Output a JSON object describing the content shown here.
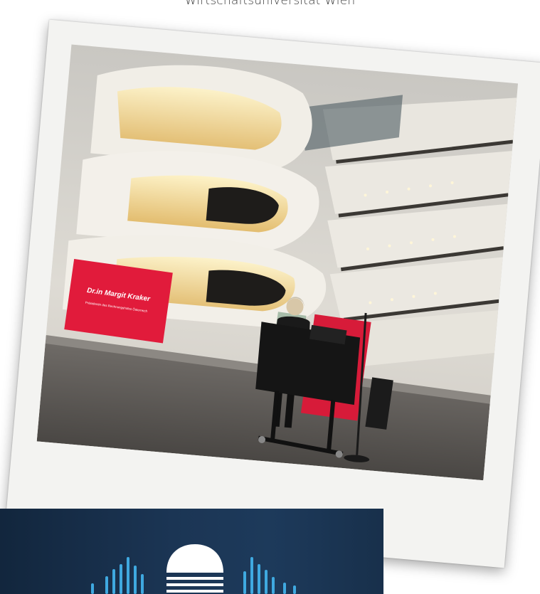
{
  "caption": "Wirtschaftsuniversität Wien",
  "photo": {
    "slide": {
      "name": "Dr.in Margit Kraker",
      "subtitle": "Präsidentin des Rechnungshofes Österreich"
    }
  },
  "colors": {
    "slide_red": "#e11b3b",
    "banner_dark": "#12263d",
    "banner_mid": "#1d3a5b",
    "logo_white": "#ffffff",
    "signal_blue": "#3fa9e0"
  },
  "banner": {
    "logo_icon": "dome-with-lines-icon",
    "signal_icon": "audio-bars-icon"
  }
}
